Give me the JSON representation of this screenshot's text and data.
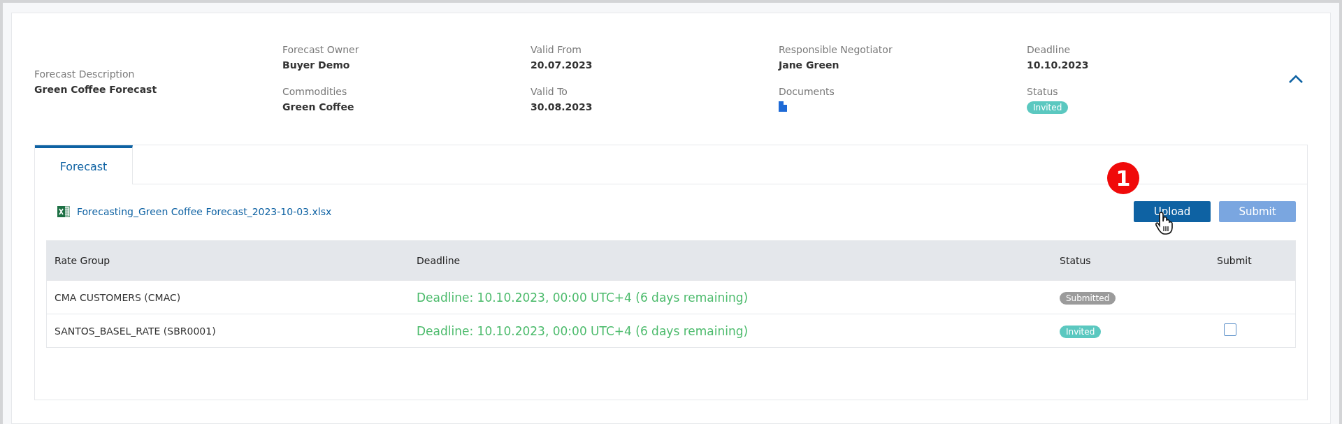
{
  "summary": {
    "description": {
      "label": "Forecast Description",
      "value": "Green Coffee Forecast"
    },
    "fields": [
      {
        "label": "Forecast Owner",
        "value": "Buyer Demo",
        "kind": "text"
      },
      {
        "label": "Valid From",
        "value": "20.07.2023",
        "kind": "text"
      },
      {
        "label": "Responsible Negotiator",
        "value": "Jane Green",
        "kind": "text"
      },
      {
        "label": "Deadline",
        "value": "10.10.2023",
        "kind": "text"
      },
      {
        "label": "Commodities",
        "value": "Green Coffee",
        "kind": "text"
      },
      {
        "label": "Valid To",
        "value": "30.08.2023",
        "kind": "text"
      },
      {
        "label": "Documents",
        "kind": "document"
      },
      {
        "label": "Status",
        "value": "Invited",
        "kind": "status",
        "color": "#5bc8c0"
      }
    ],
    "expanded": true
  },
  "tabs": [
    {
      "label": "Forecast",
      "selected": true
    }
  ],
  "file_link": "Forecasting_Green Coffee Forecast_2023-10-03.xlsx",
  "step_marker": "1",
  "buttons": [
    {
      "label": "Upload",
      "disabled": false
    },
    {
      "label": "Submit",
      "disabled": true
    }
  ],
  "table": {
    "columns": [
      "Rate Group",
      "Deadline",
      "Status",
      "Submit"
    ],
    "rows": [
      {
        "rate_group": "CMA CUSTOMERS (CMAC)",
        "deadline": "Deadline: 10.10.2023, 00:00 UTC+4 (6 days remaining)",
        "status": "Submitted",
        "color": "#9b9b9b"
      },
      {
        "rate_group": "SANTOS_BASEL_RATE (SBR0001)",
        "deadline": "Deadline: 10.10.2023, 00:00 UTC+4 (6 days remaining)",
        "status": "Invited",
        "color": "#5bc8c0",
        "checkbox": {
          "checked": false
        }
      }
    ]
  }
}
